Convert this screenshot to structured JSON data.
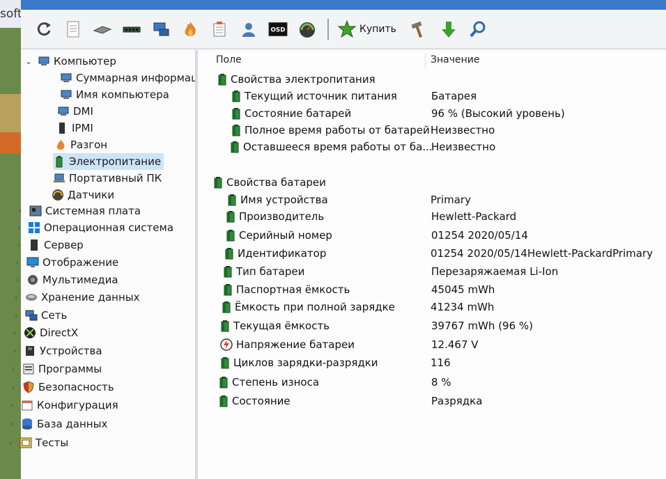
{
  "window": {
    "title_fragment": "soft"
  },
  "toolbar": {
    "buttons": [
      {
        "icon": "refresh-icon"
      },
      {
        "icon": "report-icon"
      },
      {
        "icon": "memory-icon"
      },
      {
        "icon": "ram-icon"
      },
      {
        "icon": "network-icon"
      },
      {
        "icon": "flame-icon"
      },
      {
        "icon": "schedule-icon"
      },
      {
        "icon": "user-icon"
      },
      {
        "icon": "osd-icon",
        "label": "OSD"
      },
      {
        "icon": "gauge-icon"
      }
    ],
    "buy_label": "Купить",
    "tools": [
      {
        "icon": "hammer-icon"
      },
      {
        "icon": "download-icon"
      },
      {
        "icon": "search-icon"
      }
    ]
  },
  "tree": [
    {
      "label": "Компьютер",
      "level": 0,
      "expanded": true,
      "icon": "computer-icon"
    },
    {
      "label": "Суммарная информация",
      "level": 1,
      "icon": "computer-icon"
    },
    {
      "label": "Имя компьютера",
      "level": 1,
      "icon": "computer-icon"
    },
    {
      "label": "DMI",
      "level": 1,
      "icon": "computer-icon"
    },
    {
      "label": "IPMI",
      "level": 1,
      "icon": "server-icon"
    },
    {
      "label": "Разгон",
      "level": 1,
      "icon": "flame-icon"
    },
    {
      "label": "Электропитание",
      "level": 1,
      "icon": "battery-icon",
      "selected": true
    },
    {
      "label": "Портативный ПК",
      "level": 1,
      "icon": "laptop-icon"
    },
    {
      "label": "Датчики",
      "level": 1,
      "icon": "gauge-icon"
    },
    {
      "label": "Системная плата",
      "level": 0,
      "icon": "motherboard-icon"
    },
    {
      "label": "Операционная система",
      "level": 0,
      "icon": "windows-icon"
    },
    {
      "label": "Сервер",
      "level": 0,
      "icon": "server-icon"
    },
    {
      "label": "Отображение",
      "level": 0,
      "icon": "monitor-icon"
    },
    {
      "label": "Мультимедиа",
      "level": 0,
      "icon": "speaker-icon"
    },
    {
      "label": "Хранение данных",
      "level": 0,
      "icon": "storage-icon"
    },
    {
      "label": "Сеть",
      "level": 0,
      "icon": "network-icon"
    },
    {
      "label": "DirectX",
      "level": 0,
      "icon": "xbox-icon"
    },
    {
      "label": "Устройства",
      "level": 0,
      "icon": "device-icon"
    },
    {
      "label": "Программы",
      "level": 0,
      "icon": "programs-icon"
    },
    {
      "label": "Безопасность",
      "level": 0,
      "icon": "shield-icon"
    },
    {
      "label": "Конфигурация",
      "level": 0,
      "icon": "config-icon"
    },
    {
      "label": "База данных",
      "level": 0,
      "icon": "database-icon"
    },
    {
      "label": "Тесты",
      "level": 0,
      "icon": "tests-icon"
    }
  ],
  "table": {
    "headers": {
      "field": "Поле",
      "value": "Значение"
    },
    "rows": [
      {
        "field": "Свойства электропитания",
        "value": "",
        "group": true
      },
      {
        "field": "Текущий источник питания",
        "value": "Батарея"
      },
      {
        "field": "Состояние батарей",
        "value": "96 % (Высокий уровень)"
      },
      {
        "field": "Полное время работы от батарей",
        "value": "Неизвестно"
      },
      {
        "field": "Оставшееся время работы от ба...",
        "value": "Неизвестно"
      },
      {
        "field": "Свойства батареи",
        "value": "",
        "group": true
      },
      {
        "field": "Имя устройства",
        "value": "Primary"
      },
      {
        "field": "Производитель",
        "value": "Hewlett-Packard"
      },
      {
        "field": "Серийный номер",
        "value": "01254 2020/05/14"
      },
      {
        "field": "Идентификатор",
        "value": "01254 2020/05/14Hewlett-PackardPrimary"
      },
      {
        "field": "Тип батареи",
        "value": "Перезаряжаемая Li-Ion"
      },
      {
        "field": "Паспортная ёмкость",
        "value": "45045 mWh"
      },
      {
        "field": "Ёмкость при полной зарядке",
        "value": "41234 mWh"
      },
      {
        "field": "Текущая ёмкость",
        "value": "39767 mWh  (96 %)"
      },
      {
        "field": "Напряжение батареи",
        "value": "12.467 V",
        "icon": "voltage-icon"
      },
      {
        "field": "Циклов зарядки-разрядки",
        "value": "116"
      },
      {
        "field": "Степень износа",
        "value": "8 %"
      },
      {
        "field": "Состояние",
        "value": "Разрядка"
      }
    ]
  }
}
